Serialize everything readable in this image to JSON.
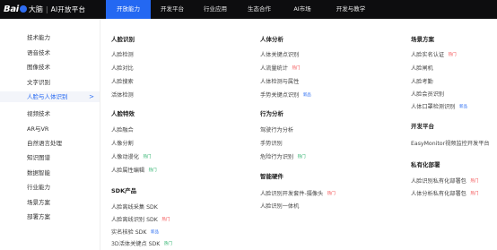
{
  "header": {
    "logo_text": "Bai",
    "logo_du": "大脑",
    "logo_sep": "|",
    "platform": "AI开放平台",
    "nav": [
      {
        "label": "开放能力",
        "active": true
      },
      {
        "label": "开发平台",
        "active": false
      },
      {
        "label": "行业应用",
        "active": false
      },
      {
        "label": "生态合作",
        "active": false
      },
      {
        "label": "AI市场",
        "active": false
      },
      {
        "label": "开发与教学",
        "active": false
      }
    ]
  },
  "sidebar": {
    "items": [
      {
        "label": "技术能力",
        "active": false
      },
      {
        "label": "语音技术",
        "active": false
      },
      {
        "label": "图像技术",
        "active": false
      },
      {
        "label": "文字识别",
        "active": false
      },
      {
        "label": "人脸与人体识别",
        "active": true
      },
      {
        "label": "视频技术",
        "active": false
      },
      {
        "label": "AR与VR",
        "active": false
      },
      {
        "label": "自然语言处理",
        "active": false
      },
      {
        "label": "知识图谱",
        "active": false
      },
      {
        "label": "数据智能",
        "active": false
      },
      {
        "label": "行业能力",
        "active": false
      },
      {
        "label": "场景方案",
        "active": false
      },
      {
        "label": "部署方案",
        "active": false
      }
    ],
    "active_chevron": ">"
  },
  "col1": {
    "face": {
      "title": "人脸识别",
      "links": [
        {
          "label": "人脸检测",
          "badge": ""
        },
        {
          "label": "人脸对比",
          "badge": ""
        },
        {
          "label": "人脸搜索",
          "badge": ""
        },
        {
          "label": "活体检测",
          "badge": ""
        }
      ]
    },
    "effects": {
      "title": "人脸特效",
      "links": [
        {
          "label": "人脸融合",
          "badge": ""
        },
        {
          "label": "人像分割",
          "badge": ""
        },
        {
          "label": "人像动漫化",
          "badge": "热门",
          "badge_type": "upd"
        },
        {
          "label": "人脸属性编辑",
          "badge": "热门",
          "badge_type": "upd"
        }
      ]
    },
    "sdk": {
      "title": "SDK产品",
      "links": [
        {
          "label": "人脸离线采集 SDK",
          "badge": ""
        },
        {
          "label": "人脸离线识别 SDK",
          "badge": "热门",
          "badge_type": "hot"
        },
        {
          "label": "实名核验 SDK",
          "badge": "新品",
          "badge_type": "new"
        },
        {
          "label": "3D活体关键点 SDK",
          "badge": "热门",
          "badge_type": "upd"
        }
      ]
    }
  },
  "col2": {
    "body": {
      "title": "人体分析",
      "links": [
        {
          "label": "人体关键点识别",
          "badge": ""
        },
        {
          "label": "人流量统计",
          "badge": "热门",
          "badge_type": "hot"
        },
        {
          "label": "人体检测与属性",
          "badge": ""
        },
        {
          "label": "手势关键点识别",
          "badge": "新品",
          "badge_type": "new"
        }
      ]
    },
    "behavior": {
      "title": "行为分析",
      "links": [
        {
          "label": "驾驶行为分析",
          "badge": ""
        },
        {
          "label": "手势识别",
          "badge": ""
        },
        {
          "label": "危险行为识别",
          "badge": "热门",
          "badge_type": "upd"
        }
      ]
    },
    "hardware": {
      "title": "智能硬件",
      "links": [
        {
          "label": "人脸识别开发套件-摄像头",
          "badge": "热门",
          "badge_type": "hot"
        },
        {
          "label": "人脸识别一体机",
          "badge": ""
        }
      ]
    }
  },
  "col3": {
    "scenes": {
      "title": "场景方案",
      "links": [
        {
          "label": "人脸实名认证",
          "badge": "热门",
          "badge_type": "hot"
        },
        {
          "label": "人脸闸机",
          "badge": ""
        },
        {
          "label": "人脸考勤",
          "badge": ""
        },
        {
          "label": "人脸会员识别",
          "badge": ""
        },
        {
          "label": "人体口罩检测识别",
          "badge": "新品",
          "badge_type": "new"
        }
      ]
    },
    "devplatform": {
      "title": "开发平台",
      "links": [
        {
          "label": "EasyMonitor视频监控开发平台",
          "badge": ""
        }
      ]
    },
    "private": {
      "title": "私有化部署",
      "links": [
        {
          "label": "人脸识别私有化部署包",
          "badge": "热门",
          "badge_type": "hot"
        },
        {
          "label": "人体分析私有化部署包",
          "badge": "热门",
          "badge_type": "hot"
        }
      ]
    }
  }
}
